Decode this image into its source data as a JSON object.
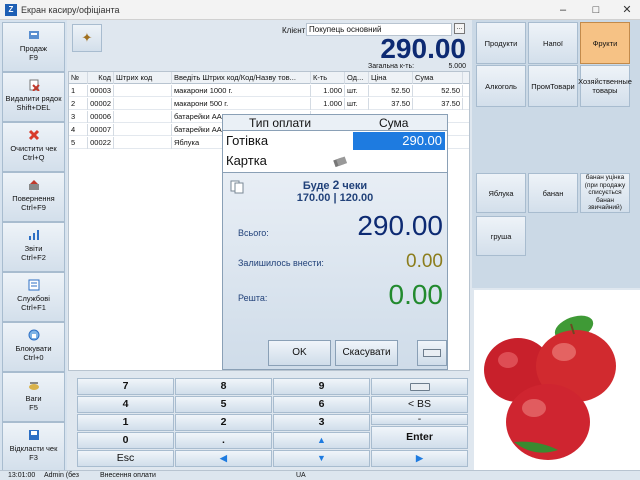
{
  "window": {
    "title": "Екран касиру/офіціанта",
    "app_icon": "POS"
  },
  "left_menu": [
    {
      "label": "Продаж",
      "shortcut": "F9",
      "icon": "sale-icon",
      "color": "#2d6fc4"
    },
    {
      "label": "Видалити рядок",
      "shortcut": "Shift+DEL",
      "icon": "delete-row-icon",
      "color": "#c0392b"
    },
    {
      "label": "Очистити чек",
      "shortcut": "Ctrl+Q",
      "icon": "clear-receipt-icon",
      "color": "#d83b2b"
    },
    {
      "label": "Повернення",
      "shortcut": "Ctrl+F9",
      "icon": "return-icon",
      "color": "#c0392b"
    },
    {
      "label": "Звіти",
      "shortcut": "Ctrl+F2",
      "icon": "reports-icon",
      "color": "#2d6fc4"
    },
    {
      "label": "Службові",
      "shortcut": "Ctrl+F1",
      "icon": "service-icon",
      "color": "#2d6fc4"
    },
    {
      "label": "Блокувати",
      "shortcut": "Ctrl+0",
      "icon": "lock-icon",
      "color": "#2d6fc4"
    },
    {
      "label": "Ваги",
      "shortcut": "F5",
      "icon": "scales-icon",
      "color": "#b08a2e"
    },
    {
      "label": "Відкласти чек",
      "shortcut": "F3",
      "icon": "postpone-icon",
      "color": "#2d6fc4"
    }
  ],
  "header": {
    "client_label": "Клієнт:",
    "client_value": "Покупець основний",
    "client_more": "...",
    "total": "290.00",
    "total_qty_label": "Загальна к-ть:",
    "total_qty": "5.000"
  },
  "table": {
    "columns": [
      "№",
      "Код",
      "Штрих код",
      "Введіть Штрих код/Код/Назву тов...",
      "К-ть",
      "Од...",
      "Ціна",
      "Сума"
    ],
    "rows": [
      [
        "1",
        "00003",
        "",
        "макарони 1000 г.",
        "1.000",
        "шт.",
        "52.50",
        "52.50"
      ],
      [
        "2",
        "00002",
        "",
        "макарони 500 г.",
        "1.000",
        "шт.",
        "37.50",
        "37.50"
      ],
      [
        "3",
        "00006",
        "",
        "батарейки АА",
        "",
        "",
        "",
        ""
      ],
      [
        "4",
        "00007",
        "",
        "батарейки АА",
        "",
        "",
        "",
        ""
      ],
      [
        "5",
        "00022",
        "",
        "Яблука",
        "",
        "",
        "",
        ""
      ]
    ]
  },
  "payment": {
    "col_type": "Тип оплати",
    "col_sum": "Сума",
    "methods": [
      {
        "name": "Готівка",
        "amount": "290.00",
        "selected": true
      },
      {
        "name": "Картка",
        "amount": "",
        "selected": false
      }
    ],
    "checks_prefix": "Буде",
    "checks_count": "2",
    "checks_suffix": "чеки",
    "checks_amounts": "170.00 | 120.00",
    "total_label": "Всього:",
    "total_value": "290.00",
    "remaining_label": "Залишилось внести:",
    "remaining_value": "0.00",
    "change_label": "Решта:",
    "change_value": "0.00",
    "ok": "OK",
    "cancel": "Скасувати"
  },
  "numpad": {
    "keys": [
      "7",
      "8",
      "9",
      "4",
      "5",
      "6",
      "1",
      "2",
      "3",
      "0",
      ".",
      "Esc"
    ],
    "backspace": "< BS",
    "minus": "-",
    "enter": "Enter"
  },
  "categories": [
    {
      "label": "Продукти",
      "active": false
    },
    {
      "label": "Напої",
      "active": false
    },
    {
      "label": "Фрукти",
      "active": true
    },
    {
      "label": "Алкоголь",
      "active": false
    },
    {
      "label": "ПромТовари",
      "active": false
    },
    {
      "label": "Хозяйственные товары",
      "active": false
    }
  ],
  "products": [
    {
      "label": "Яблука"
    },
    {
      "label": "банан"
    },
    {
      "label": "банан уцінка (при продажу списується банан звичайний)"
    },
    {
      "label": "груша"
    }
  ],
  "statusbar": {
    "time": "13:01:00",
    "user": "Admin (без",
    "mode": "Внесення оплати",
    "lang": "UA"
  },
  "colors": {
    "accent": "#1e7be0",
    "total": "#0d2a72",
    "remaining": "#8c7d1c",
    "change": "#228a2e",
    "active_category": "#f6c285"
  }
}
